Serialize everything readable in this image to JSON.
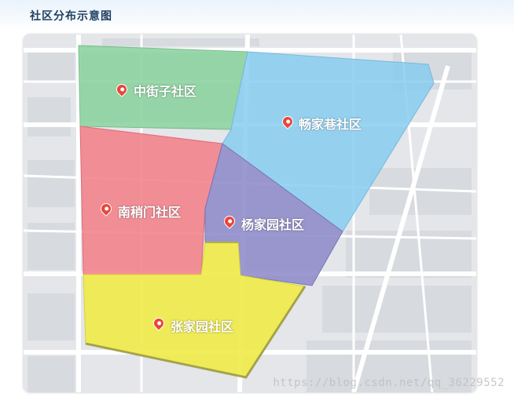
{
  "title": "社区分布示意图",
  "districts": [
    {
      "id": "zhongjiezi",
      "name": "中街子社区",
      "color": "#86d09a"
    },
    {
      "id": "changjiaxiang",
      "name": "畅家巷社区",
      "color": "#87ccf0"
    },
    {
      "id": "nanshaomen",
      "name": "南稍门社区",
      "color": "#f27c86"
    },
    {
      "id": "yangjiayuan",
      "name": "杨家园社区",
      "color": "#8b87c8"
    },
    {
      "id": "zhangjiayuan",
      "name": "张家园社区",
      "color": "#f0ea47"
    }
  ],
  "pin_color": "#e8463a",
  "watermark": "https://blog.csdn.net/qq_36229552"
}
